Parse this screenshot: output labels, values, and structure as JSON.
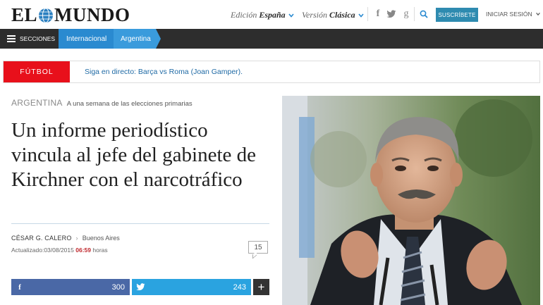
{
  "header": {
    "logo_left": "EL",
    "logo_right": "MUNDO",
    "edition_label": "Edición",
    "edition_value": "España",
    "version_label": "Versión",
    "version_value": "Clásica",
    "subscribe_label": "SUSCRÍBETE",
    "login_label": "INICIAR SESIÓN",
    "social": [
      "f",
      "twitter",
      "g"
    ]
  },
  "nav": {
    "sections_label": "SECCIONES",
    "breadcrumbs": [
      "Internacional",
      "Argentina"
    ]
  },
  "breaking": {
    "tag": "FÚTBOL",
    "text": "Siga en directo: Barça vs Roma (Joan Gamper)."
  },
  "article": {
    "section": "ARGENTINA",
    "subsection": "A una semana de las elecciones primarias",
    "headline": "Un informe periodístico vincula al jefe del gabinete de Kirchner con el narcotráfico",
    "author": "CÉSAR G. CALERO",
    "location": "Buenos Aires",
    "updated_label": "Actualizado:",
    "updated_date": "03/08/2015",
    "updated_time": "06:59",
    "updated_suffix": "horas",
    "comment_count": "15"
  },
  "share": {
    "facebook_count": "300",
    "twitter_count": "243",
    "more_label": "+"
  },
  "colors": {
    "accent_blue": "#2a8ad0",
    "breaking_red": "#e8101b",
    "facebook": "#4a68a6",
    "twitter": "#2aa3e0",
    "subscribe": "#2e8bb0"
  }
}
